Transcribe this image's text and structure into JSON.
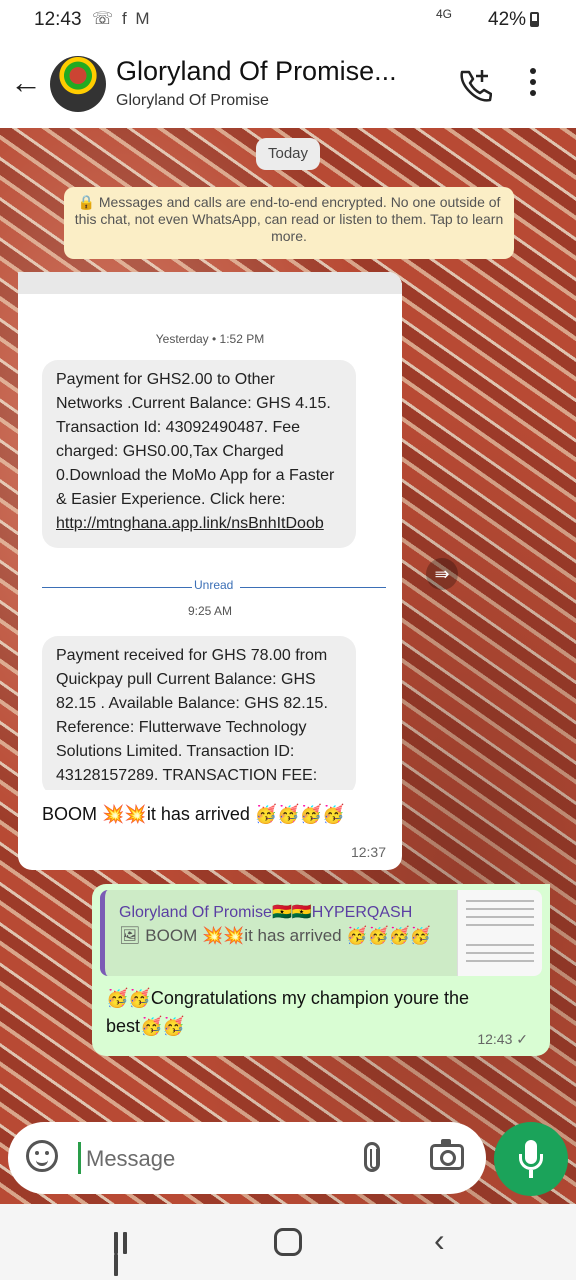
{
  "status_bar": {
    "time": "12:43",
    "notification_icons": "☏ f M",
    "network": "4G",
    "battery": "42%"
  },
  "header": {
    "title": "Gloryland Of Promise...",
    "subtitle": "Gloryland Of Promise"
  },
  "chat": {
    "date_chip": "Today",
    "encryption_notice": "🔒 Messages and calls are end-to-end encrypted. No one outside of this chat, not even WhatsApp, can read or listen to them. Tap to learn more.",
    "incoming": {
      "screenshot": {
        "yesterday_label": "Yesterday • 1:52 PM",
        "sms1_text": "Payment for GHS2.00 to Other Networks .Current Balance: GHS 4.15. Transaction Id: 43092490487. Fee charged: GHS0.00,Tax Charged 0.Download the MoMo App for a Faster & Easier Experience. Click here:",
        "sms1_link": "http://mtnghana.app.link/nsBnhItDoob",
        "unread_label": "Unread",
        "time_925": "9:25 AM",
        "sms2_text": "Payment received for GHS 78.00 from Quickpay pull Current Balance: GHS 82.15 . Available Balance: GHS 82.15. Reference: Flutterwave Technology Solutions Limited. Transaction ID: 43128157289. TRANSACTION FEE:"
      },
      "text": "BOOM 💥💥it has arrived 🥳🥳🥳🥳",
      "time": "12:37"
    },
    "outgoing": {
      "quote_name": "Gloryland Of Promise🇬🇭🇬🇭HYPERQASH",
      "quote_text": "🖼 BOOM 💥💥it has arrived 🥳🥳🥳🥳",
      "text": "🥳🥳Congratulations my champion youre the best🥳🥳",
      "time": "12:43",
      "status": "✓"
    }
  },
  "input": {
    "placeholder": "Message"
  },
  "forward_icon": "⇛",
  "nav": {
    "back_glyph": "‹"
  }
}
